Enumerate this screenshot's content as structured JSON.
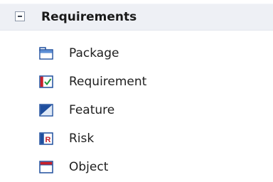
{
  "section": {
    "title": "Requirements",
    "expanded": true
  },
  "items": [
    {
      "label": "Package",
      "icon": "package-icon"
    },
    {
      "label": "Requirement",
      "icon": "requirement-icon"
    },
    {
      "label": "Feature",
      "icon": "feature-icon"
    },
    {
      "label": "Risk",
      "icon": "risk-icon"
    },
    {
      "label": "Object",
      "icon": "object-icon"
    }
  ],
  "colors": {
    "header_background": "#eef0f5",
    "icon_blue": "#1f4f9e",
    "icon_red": "#c8202a",
    "icon_green": "#1f9a3c"
  }
}
